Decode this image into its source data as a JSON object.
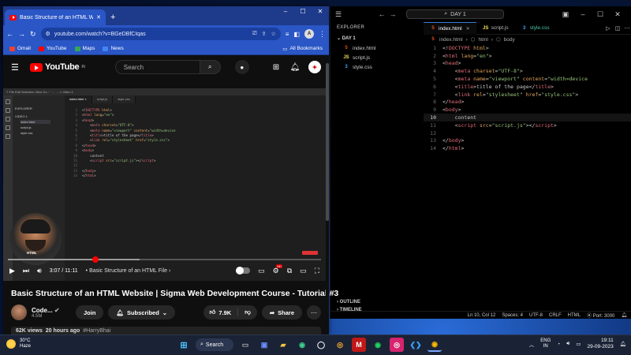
{
  "vscode": {
    "search_label": "DAY 1",
    "explorer_title": "EXPLORER",
    "folder": "DAY 1",
    "files": [
      {
        "name": "index.html",
        "type": "html",
        "icon": "5"
      },
      {
        "name": "script.js",
        "type": "js",
        "icon": "JS"
      },
      {
        "name": "style.css",
        "type": "css",
        "icon": "3"
      }
    ],
    "outline": "OUTLINE",
    "timeline": "TIMELINE",
    "tabs": [
      {
        "name": "index.html",
        "icon": "5"
      },
      {
        "name": "script.js",
        "icon": "JS"
      },
      {
        "name": "style.css",
        "icon": "3"
      }
    ],
    "breadcrumb": [
      "index.html",
      "html",
      "body"
    ],
    "code_lines": [
      {
        "n": "1",
        "parts": [
          {
            "c": "punct",
            "t": "<!"
          },
          {
            "c": "tag",
            "t": "DOCTYPE"
          },
          {
            "c": "attr",
            "t": " html"
          },
          {
            "c": "punct",
            "t": ">"
          }
        ]
      },
      {
        "n": "2",
        "parts": [
          {
            "c": "punct",
            "t": "<"
          },
          {
            "c": "tag",
            "t": "html"
          },
          {
            "c": "attr",
            "t": " lang"
          },
          {
            "c": "punct",
            "t": "="
          },
          {
            "c": "str",
            "t": "\"en\""
          },
          {
            "c": "punct",
            "t": ">"
          }
        ]
      },
      {
        "n": "3",
        "parts": [
          {
            "c": "punct",
            "t": "<"
          },
          {
            "c": "tag",
            "t": "head"
          },
          {
            "c": "punct",
            "t": ">"
          }
        ]
      },
      {
        "n": "4",
        "parts": [
          {
            "c": "punct",
            "t": "    <"
          },
          {
            "c": "tag",
            "t": "meta"
          },
          {
            "c": "attr",
            "t": " charset"
          },
          {
            "c": "punct",
            "t": "="
          },
          {
            "c": "str",
            "t": "\"UTF-8\""
          },
          {
            "c": "punct",
            "t": ">"
          }
        ]
      },
      {
        "n": "5",
        "parts": [
          {
            "c": "punct",
            "t": "    <"
          },
          {
            "c": "tag",
            "t": "meta"
          },
          {
            "c": "attr",
            "t": " name"
          },
          {
            "c": "punct",
            "t": "="
          },
          {
            "c": "str",
            "t": "\"viewport\""
          },
          {
            "c": "attr",
            "t": " content"
          },
          {
            "c": "punct",
            "t": "="
          },
          {
            "c": "str",
            "t": "\"width=device"
          }
        ]
      },
      {
        "n": "6",
        "parts": [
          {
            "c": "punct",
            "t": "    <"
          },
          {
            "c": "tag",
            "t": "title"
          },
          {
            "c": "punct",
            "t": ">"
          },
          {
            "c": "txt",
            "t": "title of the page"
          },
          {
            "c": "punct",
            "t": "</"
          },
          {
            "c": "tag",
            "t": "title"
          },
          {
            "c": "punct",
            "t": ">"
          }
        ]
      },
      {
        "n": "7",
        "parts": [
          {
            "c": "punct",
            "t": "    <"
          },
          {
            "c": "tag",
            "t": "link"
          },
          {
            "c": "attr",
            "t": " rel"
          },
          {
            "c": "punct",
            "t": "="
          },
          {
            "c": "str",
            "t": "\"stylesheet\""
          },
          {
            "c": "attr",
            "t": " href"
          },
          {
            "c": "punct",
            "t": "="
          },
          {
            "c": "str",
            "t": "\"style.css\""
          },
          {
            "c": "punct",
            "t": ">"
          }
        ]
      },
      {
        "n": "8",
        "parts": [
          {
            "c": "punct",
            "t": "</"
          },
          {
            "c": "tag",
            "t": "head"
          },
          {
            "c": "punct",
            "t": ">"
          }
        ]
      },
      {
        "n": "9",
        "parts": [
          {
            "c": "punct",
            "t": "<"
          },
          {
            "c": "tag",
            "t": "body"
          },
          {
            "c": "punct",
            "t": ">"
          }
        ]
      },
      {
        "n": "10",
        "parts": [
          {
            "c": "txt",
            "t": "    content"
          }
        ]
      },
      {
        "n": "11",
        "parts": [
          {
            "c": "punct",
            "t": "    <"
          },
          {
            "c": "tag",
            "t": "script"
          },
          {
            "c": "attr",
            "t": " src"
          },
          {
            "c": "punct",
            "t": "="
          },
          {
            "c": "str",
            "t": "\"script.js\""
          },
          {
            "c": "punct",
            "t": "></"
          },
          {
            "c": "tag",
            "t": "script"
          },
          {
            "c": "punct",
            "t": ">"
          }
        ]
      },
      {
        "n": "12",
        "parts": []
      },
      {
        "n": "13",
        "parts": [
          {
            "c": "punct",
            "t": "</"
          },
          {
            "c": "tag",
            "t": "body"
          },
          {
            "c": "punct",
            "t": ">"
          }
        ]
      },
      {
        "n": "14",
        "parts": [
          {
            "c": "punct",
            "t": "</"
          },
          {
            "c": "tag",
            "t": "html"
          },
          {
            "c": "punct",
            "t": ">"
          }
        ]
      }
    ],
    "current_line": "10",
    "status": [
      "Ln 10, Col 12",
      "Spaces: 4",
      "UTF-8",
      "CRLF",
      "HTML",
      "Port: 3000"
    ]
  },
  "chrome": {
    "tab_title": "Basic Structure of an HTML Website",
    "url": "youtube.com/watch?v=BGeDBfCIqas",
    "profile_initial": "A",
    "bookmarks": [
      {
        "label": "Gmail",
        "color": "#ea4335"
      },
      {
        "label": "YouTube",
        "color": "#ff0000"
      },
      {
        "label": "Maps",
        "color": "#34a853"
      },
      {
        "label": "News",
        "color": "#4285f4"
      }
    ],
    "all_bookmarks": "All Bookmarks"
  },
  "youtube": {
    "logo_text": "YouTube",
    "logo_region": "IN",
    "search_placeholder": "Search",
    "video_title": "Basic Structure of an HTML Website | Sigma Web Development Course - Tutorial #3",
    "channel_name": "Code...",
    "subscribers": "4.5M",
    "join_label": "Join",
    "subscribed_label": "Subscribed",
    "likes": "7.9K",
    "share_label": "Share",
    "views": "62K views",
    "posted": "20 hours ago",
    "hashtag": "#HarryBhai",
    "time_current": "3:07",
    "time_total": "11:11",
    "chapter": "Basic Structure of an HTML File",
    "progress": 0.28,
    "buffered": 0.42,
    "video_overlay_label": "HTML"
  },
  "taskbar": {
    "temperature": "30°C",
    "weather": "Haze",
    "search_label": "Search",
    "lang_top": "ENG",
    "lang_bottom": "IN",
    "time": "19:11",
    "date": "29-09-2023"
  }
}
